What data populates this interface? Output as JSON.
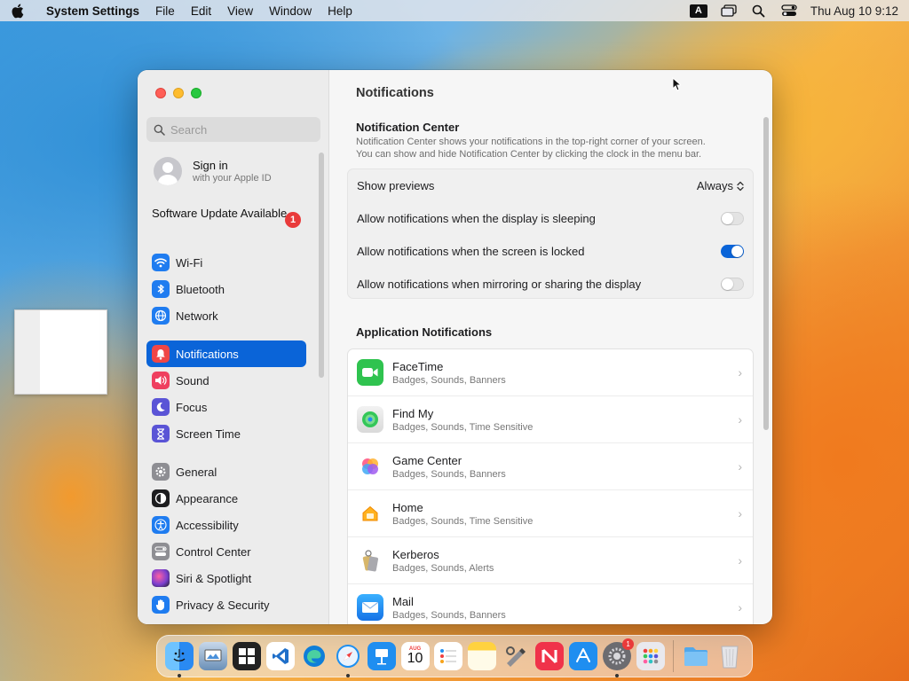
{
  "menubar": {
    "app_name": "System Settings",
    "menus": [
      "File",
      "Edit",
      "View",
      "Window",
      "Help"
    ],
    "input_source": "A",
    "clock": "Thu Aug 10  9:12"
  },
  "window": {
    "search": {
      "placeholder": "Search"
    },
    "account": {
      "title": "Sign in",
      "subtitle": "with your Apple ID"
    },
    "update": {
      "label": "Software Update Available",
      "badge": "1"
    },
    "sidebar_groups": [
      [
        {
          "label": "Wi-Fi",
          "icon": "wifi-icon",
          "color": "#1f7cf0"
        },
        {
          "label": "Bluetooth",
          "icon": "bluetooth-icon",
          "color": "#1f7cf0"
        },
        {
          "label": "Network",
          "icon": "network-globe-icon",
          "color": "#1f7cf0"
        }
      ],
      [
        {
          "label": "Notifications",
          "icon": "bell-icon",
          "color": "#ef4646",
          "active": true
        },
        {
          "label": "Sound",
          "icon": "speaker-icon",
          "color": "#ef3f5f"
        },
        {
          "label": "Focus",
          "icon": "moon-icon",
          "color": "#5a54d6"
        },
        {
          "label": "Screen Time",
          "icon": "hourglass-icon",
          "color": "#5a54d6"
        }
      ],
      [
        {
          "label": "General",
          "icon": "gear-icon",
          "color": "#8e8e93"
        },
        {
          "label": "Appearance",
          "icon": "appearance-icon",
          "color": "#1d1d1f"
        },
        {
          "label": "Accessibility",
          "icon": "accessibility-icon",
          "color": "#1f7cf0"
        },
        {
          "label": "Control Center",
          "icon": "control-center-icon",
          "color": "#8e8e93"
        },
        {
          "label": "Siri & Spotlight",
          "icon": "siri-icon",
          "color": "#7a3fd0"
        },
        {
          "label": "Privacy & Security",
          "icon": "hand-icon",
          "color": "#1f7cf0"
        }
      ]
    ],
    "main": {
      "title": "Notifications",
      "nc_title": "Notification Center",
      "nc_desc_1": "Notification Center shows your notifications in the top-right corner of your screen.",
      "nc_desc_2": "You can show and hide Notification Center by clicking the clock in the menu bar.",
      "prefs": [
        {
          "label": "Show previews",
          "type": "select",
          "value": "Always"
        },
        {
          "label": "Allow notifications when the display is sleeping",
          "type": "toggle",
          "on": false
        },
        {
          "label": "Allow notifications when the screen is locked",
          "type": "toggle",
          "on": true
        },
        {
          "label": "Allow notifications when mirroring or sharing the display",
          "type": "toggle",
          "on": false
        }
      ],
      "apps_title": "Application Notifications",
      "apps": [
        {
          "name": "FaceTime",
          "detail": "Badges, Sounds, Banners",
          "icon": "facetime-icon",
          "color": "#2fc34f"
        },
        {
          "name": "Find My",
          "detail": "Badges, Sounds, Time Sensitive",
          "icon": "findmy-icon",
          "color": "#34c759"
        },
        {
          "name": "Game Center",
          "detail": "Badges, Sounds, Banners",
          "icon": "game-center-icon",
          "color": "#ffffff"
        },
        {
          "name": "Home",
          "detail": "Badges, Sounds, Time Sensitive",
          "icon": "home-icon",
          "color": "#ffffff"
        },
        {
          "name": "Kerberos",
          "detail": "Badges, Sounds, Alerts",
          "icon": "kerberos-icon",
          "color": "#ffffff"
        },
        {
          "name": "Mail",
          "detail": "Badges, Sounds, Banners",
          "icon": "mail-icon",
          "color": "#1f8ef0"
        }
      ]
    }
  },
  "dock": {
    "items": [
      {
        "icon": "finder-icon",
        "color": "#2a8af2",
        "running": true
      },
      {
        "icon": "preview-icon",
        "color": "#6a8fb7",
        "running": false
      },
      {
        "icon": "photo-booth-icon",
        "color": "#222222",
        "running": false
      },
      {
        "icon": "vscode-icon",
        "color": "#1f6fc9",
        "running": false
      },
      {
        "icon": "edge-icon",
        "color": "#0f7ed8",
        "running": false
      },
      {
        "icon": "safari-icon",
        "color": "#1d8ff0",
        "running": true
      },
      {
        "icon": "keynote-icon",
        "color": "#1f8ef0",
        "running": false
      },
      {
        "icon": "calendar-icon",
        "color": "#ffffff",
        "running": false,
        "month": "AUG",
        "day": "10"
      },
      {
        "icon": "reminders-icon",
        "color": "#ffffff",
        "running": false
      },
      {
        "icon": "notes-icon",
        "color": "#ffd23f",
        "running": false
      },
      {
        "icon": "script-editor-icon",
        "color": "#8e8e93",
        "running": false
      },
      {
        "icon": "news-icon",
        "color": "#f0334a",
        "running": false
      },
      {
        "icon": "app-store-icon",
        "color": "#1f8ef0",
        "running": false
      },
      {
        "icon": "system-settings-icon",
        "color": "#6c6c70",
        "running": true,
        "badge": "1"
      },
      {
        "icon": "launchpad-icon",
        "color": "#e9e9ee",
        "running": false
      }
    ],
    "right_items": [
      {
        "icon": "downloads-folder-icon",
        "color": "#52a8ea"
      },
      {
        "icon": "trash-icon",
        "color": "#e4e4e8"
      }
    ]
  }
}
